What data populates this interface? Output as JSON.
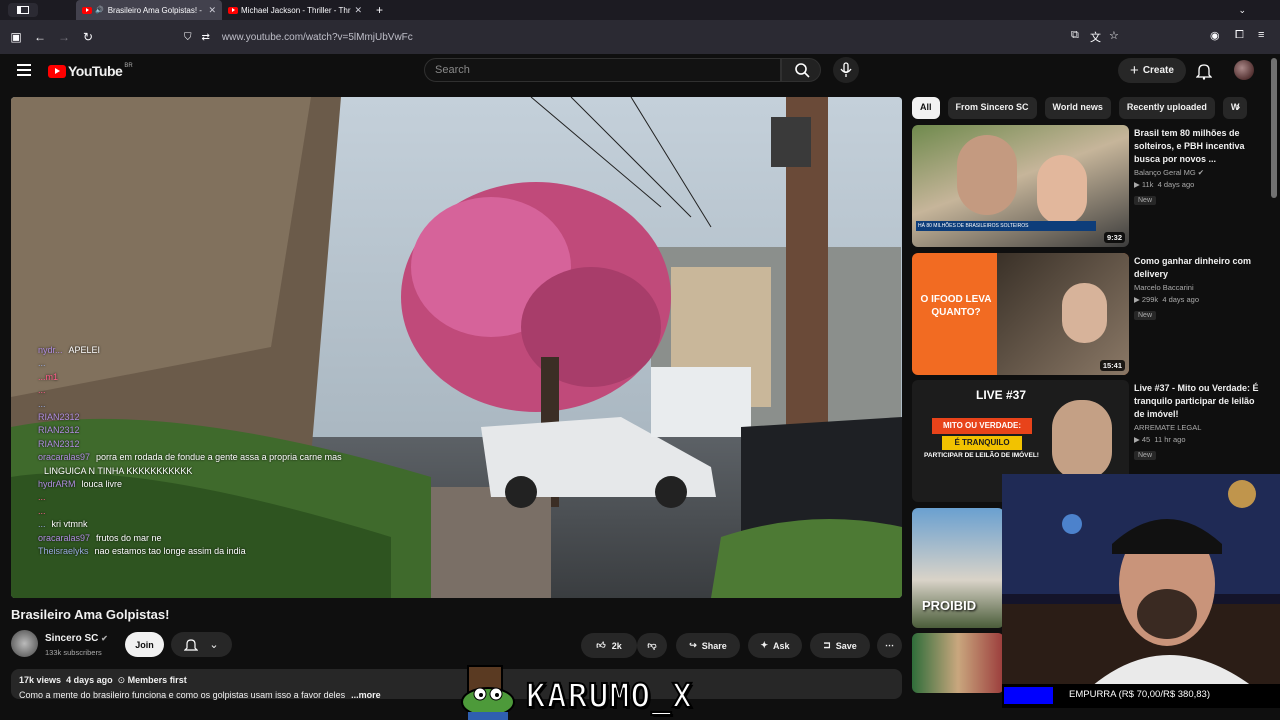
{
  "browser": {
    "tabs": [
      {
        "title": "Brasileiro Ama Golpistas! -",
        "active": true
      },
      {
        "title": "Michael Jackson - Thriller - Thr",
        "active": false
      }
    ],
    "url": "www.youtube.com/watch?v=5lMmjUbVwFc"
  },
  "header": {
    "logo_text": "YouTube",
    "country_code": "BR",
    "search_placeholder": "Search",
    "create_label": "Create"
  },
  "chat": [
    {
      "user": "nydr...",
      "msg": "APELEI",
      "cls": "u1"
    },
    {
      "user": "...",
      "msg": "",
      "cls": "u2"
    },
    {
      "user": "...m1",
      "msg": "",
      "cls": "u3"
    },
    {
      "user": "...",
      "msg": "",
      "cls": "u3"
    },
    {
      "user": "...",
      "msg": "",
      "cls": "u2"
    },
    {
      "user": "RIAN2312",
      "msg": "",
      "cls": "u1"
    },
    {
      "user": "RIAN2312",
      "msg": "",
      "cls": "u1"
    },
    {
      "user": "RIAN2312",
      "msg": "",
      "cls": "u1"
    },
    {
      "user": "oracaralas97",
      "msg": "porra em rodada de fondue a gente assa a propria carne mas",
      "cls": "u1"
    },
    {
      "user": "",
      "msg": "LINGUICA N TINHA KKKKKKKKKKK",
      "cls": "u1"
    },
    {
      "user": "hydrARM",
      "msg": "louca livre",
      "cls": "u1"
    },
    {
      "user": "...",
      "msg": "",
      "cls": "u3"
    },
    {
      "user": "...",
      "msg": "",
      "cls": "u3"
    },
    {
      "user": "...",
      "msg": "kri vtmnk",
      "cls": "u2"
    },
    {
      "user": "oracaralas97",
      "msg": "frutos do mar ne",
      "cls": "u1"
    },
    {
      "user": "Theisraelyks",
      "msg": "nao estamos tao longe assim da india",
      "cls": "u2"
    }
  ],
  "video": {
    "title": "Brasileiro Ama Golpistas!",
    "channel": "Sincero SC",
    "subscribers": "133k subscribers",
    "join_label": "Join",
    "likes": "2k",
    "share_label": "Share",
    "ask_label": "Ask",
    "save_label": "Save",
    "views": "17k views",
    "age": "4 days ago",
    "members": "Members first",
    "description": "Como a mente do brasileiro funciona e como os golpistas usam isso a favor deles",
    "more_label": "...more"
  },
  "chips": [
    "All",
    "From Sincero SC",
    "World news",
    "Recently uploaded",
    "W"
  ],
  "recommendations": [
    {
      "title": "Brasil tem 80 milhões de solteiros, e PBH incentiva busca por novos ...",
      "channel": "Balanço Geral MG",
      "views": "11k",
      "age": "4 days ago",
      "duration": "9:32",
      "badge": "New",
      "thumb_text": "HÁ 80 MILHÕES DE BRASILEIROS SOLTEIROS"
    },
    {
      "title": "Como ganhar dinheiro com delivery",
      "channel": "Marcelo Baccarini",
      "views": "299k",
      "age": "4 days ago",
      "duration": "15:41",
      "badge": "New",
      "thumb_text": "O IFOOD LEVA QUANTO?"
    },
    {
      "title": "Live #37 - Mito ou Verdade: É tranquilo participar de leilão de imóvel!",
      "channel": "ARREMATE LEGAL",
      "views": "45",
      "age": "11 hr ago",
      "duration": "",
      "badge": "New",
      "thumb_text": "LIVE #37",
      "thumb_sub": "MITO OU VERDADE:",
      "thumb_sub2": "É TRANQUILO",
      "thumb_sub3": "PARTICIPAR DE LEILÃO DE IMÓVEL!"
    },
    {
      "title": "",
      "channel": "",
      "views": "",
      "age": "",
      "duration": "",
      "badge": "",
      "thumb_text": "PROIBID"
    }
  ],
  "overlay": {
    "brand": "KARUMO_X",
    "donation": "EMPURRA (R$ 70,00/R$ 380,83)",
    "donation_progress": 0.18
  },
  "colors": {
    "yt_red": "#ff0000",
    "bg": "#0f0f0f",
    "chip": "#272727",
    "donation_bar": "#0000ff"
  }
}
